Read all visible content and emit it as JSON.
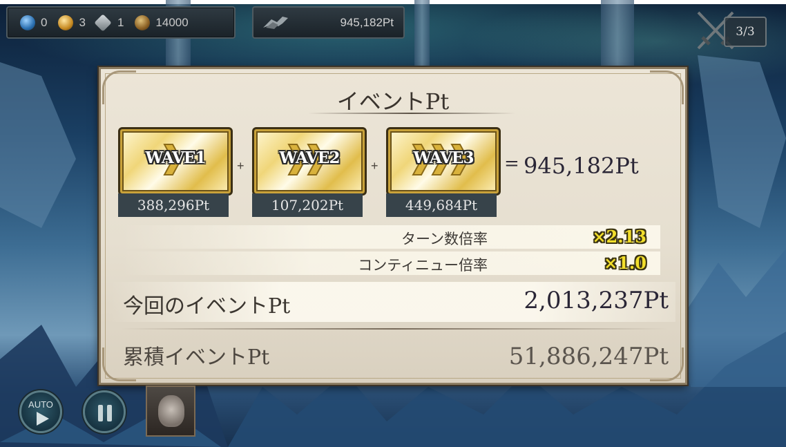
{
  "resources": [
    {
      "icon": "blue-orb-icon",
      "color": "#3f8fd0",
      "value": "0"
    },
    {
      "icon": "gold-orb-icon",
      "color": "#d7a23a",
      "value": "3"
    },
    {
      "icon": "silver-gem-icon",
      "color": "#8a8f94",
      "value": "1"
    },
    {
      "icon": "bronze-coin-icon",
      "color": "#a07a3a",
      "value": "14000"
    }
  ],
  "event_points_bar": {
    "value": "945,182Pt"
  },
  "wave_counter": {
    "current": "3",
    "total": "3"
  },
  "panel": {
    "title": "イベントPt",
    "waves": [
      {
        "label": "WAVE1",
        "points": "388,296Pt",
        "arrows": 1
      },
      {
        "label": "WAVE2",
        "points": "107,202Pt",
        "arrows": 2
      },
      {
        "label": "WAVE3",
        "points": "449,684Pt",
        "arrows": 3
      }
    ],
    "plus_sign": "+",
    "equals_sign": "=",
    "wave_total": "945,182Pt",
    "multipliers": [
      {
        "label": "ターン数倍率",
        "value": "×2.13"
      },
      {
        "label": "コンティニュー倍率",
        "value": "×1.0"
      }
    ],
    "current_event_label": "今回のイベントPt",
    "current_event_value": "2,013,237Pt",
    "accumulated_label": "累積イベントPt",
    "accumulated_value": "51,886,247Pt"
  },
  "controls": {
    "auto_label": "AUTO"
  }
}
